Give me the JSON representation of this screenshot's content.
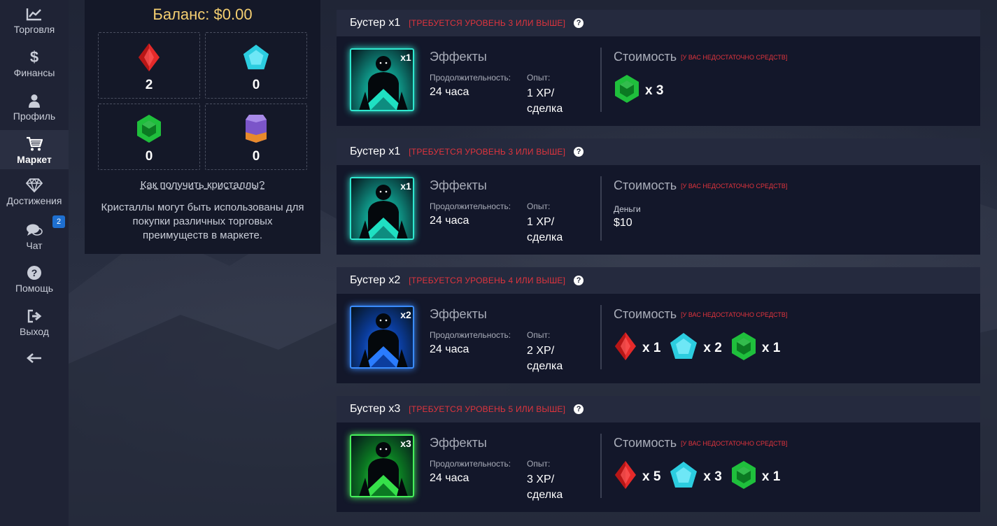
{
  "sidebar": {
    "items": [
      {
        "label": "Торговля",
        "icon": "chart-line-icon"
      },
      {
        "label": "Финансы",
        "icon": "dollar-icon"
      },
      {
        "label": "Профиль",
        "icon": "user-icon"
      },
      {
        "label": "Маркет",
        "icon": "cart-icon",
        "active": true
      },
      {
        "label": "Достижения",
        "icon": "diamond-icon"
      },
      {
        "label": "Чат",
        "icon": "chat-icon",
        "badge": "2"
      },
      {
        "label": "Помощь",
        "icon": "question-circle-icon"
      },
      {
        "label": "Выход",
        "icon": "sign-out-icon"
      }
    ],
    "collapse_icon": "arrow-left-icon"
  },
  "balance": {
    "title": "Баланс: $0.00",
    "crystals": [
      {
        "type": "red",
        "count": "2"
      },
      {
        "type": "cyan",
        "count": "0"
      },
      {
        "type": "green",
        "count": "0"
      },
      {
        "type": "purple",
        "count": "0"
      }
    ],
    "how_link": "Как получить кристаллы?",
    "description": "Кристаллы могут быть использованы для покупки различных торговых преимуществ в маркете."
  },
  "labels": {
    "effects": "Эффекты",
    "duration": "Продолжительность:",
    "xp": "Опыт:",
    "cost": "Стоимость",
    "cost_warning": "[У ВАС НЕДОСТАТОЧНО СРЕДСТВ]",
    "money": "Деньги",
    "help": "?"
  },
  "boosters": [
    {
      "title": "Бустер x1",
      "requirement": "[ТРЕБУЕТСЯ УРОВЕНЬ 3 ИЛИ ВЫШЕ]",
      "badge": "x1",
      "theme": "teal",
      "duration": "24 часа",
      "xp": "1 XP/ сделка",
      "cost_type": "crystals",
      "cost": [
        {
          "gem": "green",
          "mult": "x 3"
        }
      ]
    },
    {
      "title": "Бустер x1",
      "requirement": "[ТРЕБУЕТСЯ УРОВЕНЬ 3 ИЛИ ВЫШЕ]",
      "badge": "x1",
      "theme": "teal",
      "duration": "24 часа",
      "xp": "1 XP/ сделка",
      "cost_type": "money",
      "money": "$10"
    },
    {
      "title": "Бустер x2",
      "requirement": "[ТРЕБУЕТСЯ УРОВЕНЬ 4 ИЛИ ВЫШЕ]",
      "badge": "x2",
      "theme": "blue",
      "duration": "24 часа",
      "xp": "2 XP/ сделка",
      "cost_type": "crystals",
      "cost": [
        {
          "gem": "red",
          "mult": "x 1"
        },
        {
          "gem": "cyan",
          "mult": "x 2"
        },
        {
          "gem": "green",
          "mult": "x 1"
        }
      ]
    },
    {
      "title": "Бустер x3",
      "requirement": "[ТРЕБУЕТСЯ УРОВЕНЬ 5 ИЛИ ВЫШЕ]",
      "badge": "x3",
      "theme": "green",
      "duration": "24 часа",
      "xp": "3 XP/ сделка",
      "cost_type": "crystals",
      "cost": [
        {
          "gem": "red",
          "mult": "x 5"
        },
        {
          "gem": "cyan",
          "mult": "x 3"
        },
        {
          "gem": "green",
          "mult": "x 1"
        }
      ]
    }
  ],
  "colors": {
    "balance_title": "#f5cf71",
    "requirement": "#e0343d",
    "badge": "#1e6fd0",
    "gem_red": "#e52a2a",
    "gem_cyan": "#2ccde0",
    "gem_green": "#1fbf3c",
    "gem_purple": "#7b55c9"
  }
}
